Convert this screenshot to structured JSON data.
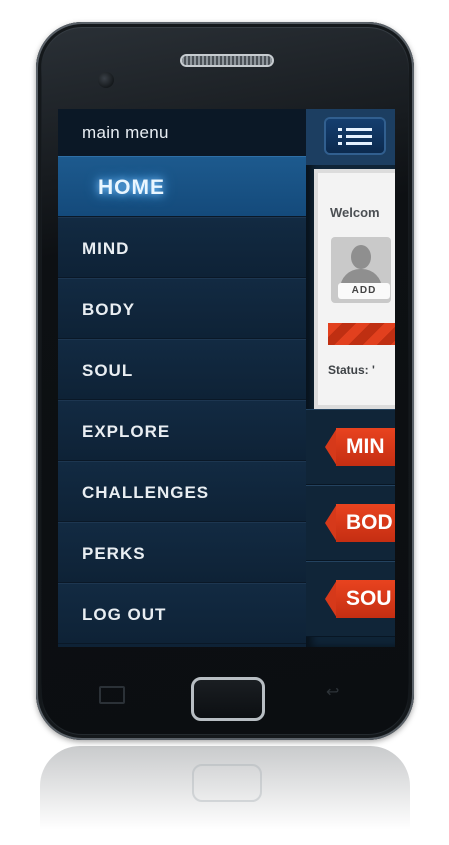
{
  "menu": {
    "title": "main menu",
    "items": [
      {
        "label": "HOME",
        "active": true
      },
      {
        "label": "MIND",
        "active": false
      },
      {
        "label": "BODY",
        "active": false
      },
      {
        "label": "SOUL",
        "active": false
      },
      {
        "label": "EXPLORE",
        "active": false
      },
      {
        "label": "CHALLENGES",
        "active": false
      },
      {
        "label": "PERKS",
        "active": false
      },
      {
        "label": "LOG OUT",
        "active": false
      }
    ]
  },
  "content": {
    "welcome": "Welcom",
    "add_button": "ADD",
    "status": "Status: '",
    "sections": [
      {
        "label": "MIN"
      },
      {
        "label": "BOD"
      },
      {
        "label": "SOU"
      }
    ]
  },
  "icons": {
    "list_button": "list-icon",
    "avatar": "user-silhouette-icon"
  },
  "colors": {
    "menu_bg": "#0e2236",
    "menu_active": "#1d5a8e",
    "accent_orange": "#e2401e"
  }
}
